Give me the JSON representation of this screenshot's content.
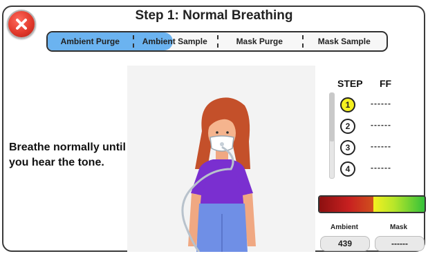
{
  "header": {
    "title": "Step 1: Normal Breathing",
    "close_icon": "close-icon"
  },
  "tabs": {
    "progress": 0.37,
    "items": [
      {
        "label": "Ambient Purge"
      },
      {
        "label": "Ambient Sample"
      },
      {
        "label": "Mask Purge"
      },
      {
        "label": "Mask Sample"
      }
    ]
  },
  "instruction": "Breathe normally until you hear the tone.",
  "steps_table": {
    "step_header": "STEP",
    "ff_header": "FF",
    "rows": [
      {
        "num": "1",
        "ff": "------",
        "active": true
      },
      {
        "num": "2",
        "ff": "------",
        "active": false
      },
      {
        "num": "3",
        "ff": "------",
        "active": false
      },
      {
        "num": "4",
        "ff": "------",
        "active": false
      }
    ]
  },
  "readings": {
    "ambient_label": "Ambient",
    "ambient_value": "439",
    "mask_label": "Mask",
    "mask_value": "------"
  },
  "colors": {
    "tab_progress": "#6bb3f0",
    "active_step": "#f4f020",
    "close_button": "#e23a2c"
  }
}
